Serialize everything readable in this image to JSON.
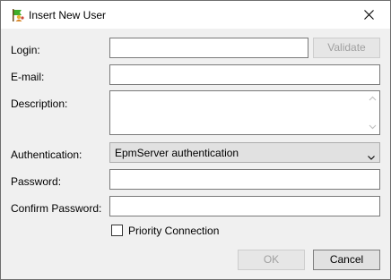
{
  "window": {
    "title": "Insert New User"
  },
  "form": {
    "login_label": "Login:",
    "email_label": "E-mail:",
    "description_label": "Description:",
    "authentication_label": "Authentication:",
    "authentication_value": "EpmServer authentication",
    "password_label": "Password:",
    "confirm_password_label": "Confirm Password:",
    "login_value": "",
    "email_value": "",
    "description_value": "",
    "password_value": "",
    "confirm_password_value": "",
    "priority_connection_label": "Priority Connection",
    "priority_connection_checked": false
  },
  "buttons": {
    "validate_label": "Validate",
    "ok_label": "OK",
    "cancel_label": "Cancel"
  },
  "icons": {
    "app": "users-flag-icon",
    "close": "close-icon",
    "dropdown": "chevron-down-icon",
    "scroll_up": "scroll-up-arrow-icon",
    "scroll_down": "scroll-down-arrow-icon"
  }
}
